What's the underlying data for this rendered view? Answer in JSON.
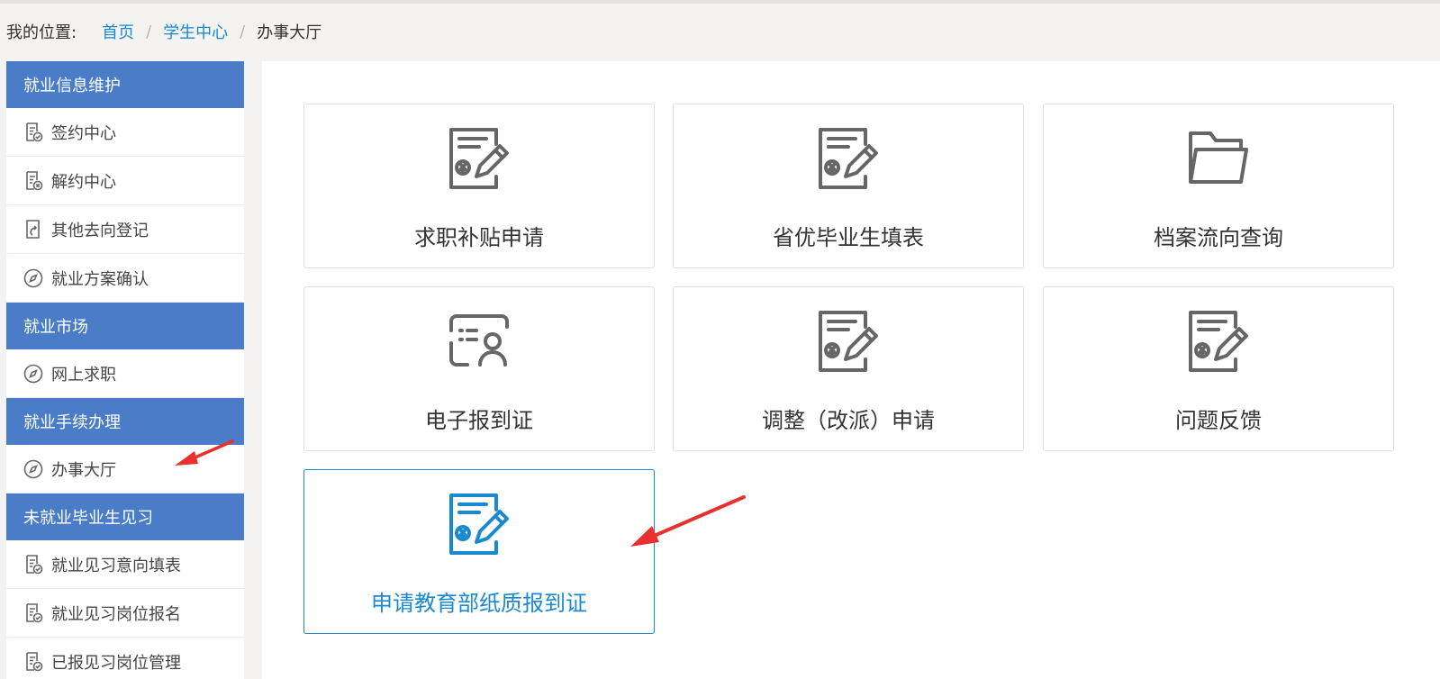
{
  "breadcrumb": {
    "prefix": "我的位置:",
    "items": [
      "首页",
      "学生中心"
    ],
    "current": "办事大厅"
  },
  "sidebar": {
    "sections": [
      {
        "title": "就业信息维护",
        "items": [
          {
            "label": "签约中心",
            "icon": "doc-check-icon"
          },
          {
            "label": "解约中心",
            "icon": "doc-x-icon"
          },
          {
            "label": "其他去向登记",
            "icon": "doc-arrow-icon"
          },
          {
            "label": "就业方案确认",
            "icon": "compass-icon"
          }
        ]
      },
      {
        "title": "就业市场",
        "items": [
          {
            "label": "网上求职",
            "icon": "compass-icon"
          }
        ]
      },
      {
        "title": "就业手续办理",
        "items": [
          {
            "label": "办事大厅",
            "icon": "compass-icon"
          }
        ]
      },
      {
        "title": "未就业毕业生见习",
        "items": [
          {
            "label": "就业见习意向填表",
            "icon": "doc-check-icon"
          },
          {
            "label": "就业见习岗位报名",
            "icon": "doc-check-icon"
          },
          {
            "label": "已报见习岗位管理",
            "icon": "doc-check-icon"
          }
        ]
      }
    ]
  },
  "tiles": [
    {
      "label": "求职补贴申请",
      "icon": "doc-edit-icon"
    },
    {
      "label": "省优毕业生填表",
      "icon": "doc-edit-icon"
    },
    {
      "label": "档案流向查询",
      "icon": "folder-icon"
    },
    {
      "label": "电子报到证",
      "icon": "id-card-icon"
    },
    {
      "label": "调整（改派）申请",
      "icon": "doc-edit-icon"
    },
    {
      "label": "问题反馈",
      "icon": "doc-edit-icon"
    },
    {
      "label": "申请教育部纸质报到证",
      "icon": "doc-edit-icon"
    }
  ],
  "colors": {
    "sidebar_header": "#4a7cc7",
    "link": "#1a8ad0",
    "icon_gray": "#666666",
    "annotation_arrow": "#e8302f"
  }
}
